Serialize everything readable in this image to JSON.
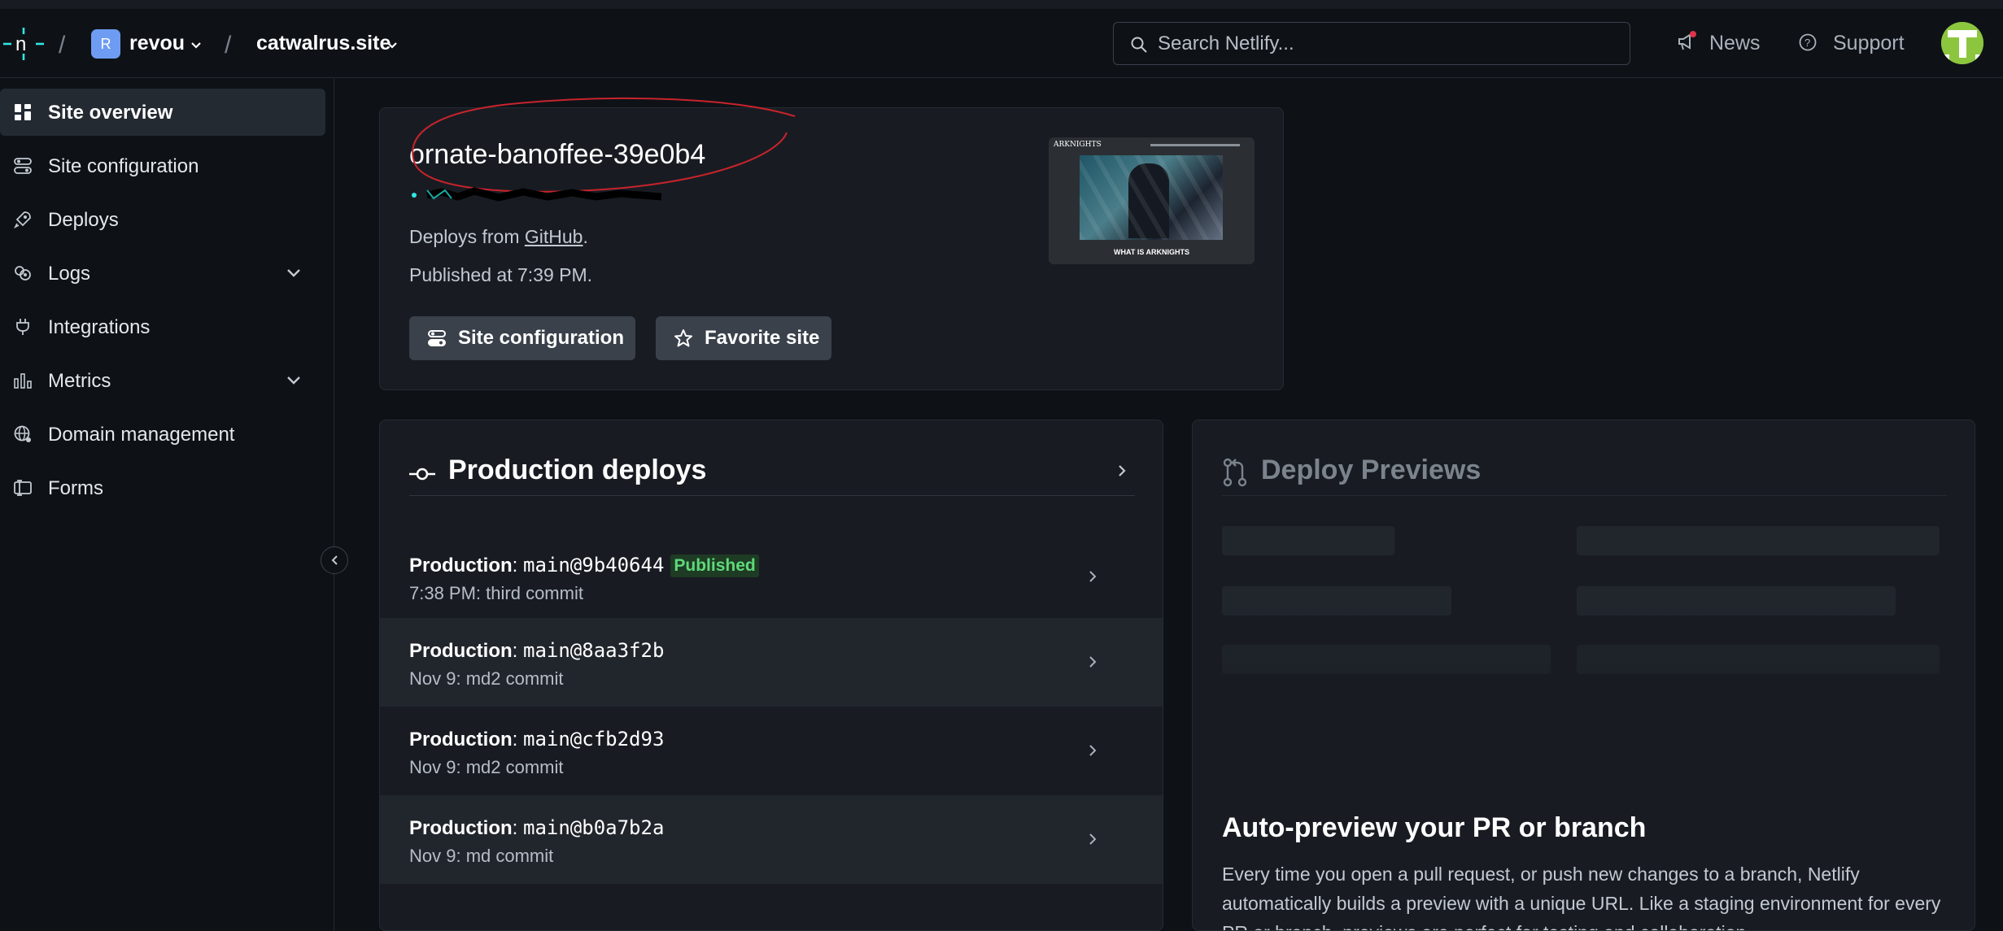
{
  "header": {
    "team_initial": "R",
    "team_name": "revou",
    "site_name": "catwalrus.site",
    "search_placeholder": "Search Netlify...",
    "news_label": "News",
    "support_label": "Support"
  },
  "sidebar": {
    "items": [
      {
        "label": "Site overview",
        "icon": "grid-icon",
        "active": true
      },
      {
        "label": "Site configuration",
        "icon": "toggles-icon"
      },
      {
        "label": "Deploys",
        "icon": "rocket-icon"
      },
      {
        "label": "Logs",
        "icon": "logs-icon",
        "expandable": true
      },
      {
        "label": "Integrations",
        "icon": "plug-icon"
      },
      {
        "label": "Metrics",
        "icon": "bar-chart-icon",
        "expandable": true
      },
      {
        "label": "Domain management",
        "icon": "globe-icon"
      },
      {
        "label": "Forms",
        "icon": "form-icon"
      }
    ]
  },
  "site": {
    "name": "ornate-banoffee-39e0b4",
    "deploys_from_prefix": "Deploys from ",
    "deploys_from_link": "GitHub",
    "deploys_from_suffix": ".",
    "published": "Published at 7:39 PM.",
    "btn_config": "Site configuration",
    "btn_favorite": "Favorite site",
    "thumb_brand": "ARKNIGHTS",
    "thumb_caption": "WHAT IS ARKNIGHTS"
  },
  "production": {
    "title": "Production deploys",
    "rows": [
      {
        "prefix": "Production",
        "ref": "main@9b40644",
        "badge": "Published",
        "sub": "7:38 PM: third commit"
      },
      {
        "prefix": "Production",
        "ref": "main@8aa3f2b",
        "sub": "Nov 9: md2 commit"
      },
      {
        "prefix": "Production",
        "ref": "main@cfb2d93",
        "sub": "Nov 9: md2 commit"
      },
      {
        "prefix": "Production",
        "ref": "main@b0a7b2a",
        "sub": "Nov 9: md commit"
      }
    ]
  },
  "previews": {
    "title": "Deploy Previews",
    "heading": "Auto-preview your PR or branch",
    "text": "Every time you open a pull request, or push new changes to a branch, Netlify automatically builds a preview with a unique URL. Like a staging environment for every PR or branch, previews are perfect for testing and collaboration."
  },
  "colors": {
    "background": "#0e1217",
    "card": "#181c22",
    "accent_teal": "#32e6e2",
    "badge_green": "#5fd97a",
    "annotation_red": "#c8232c"
  }
}
